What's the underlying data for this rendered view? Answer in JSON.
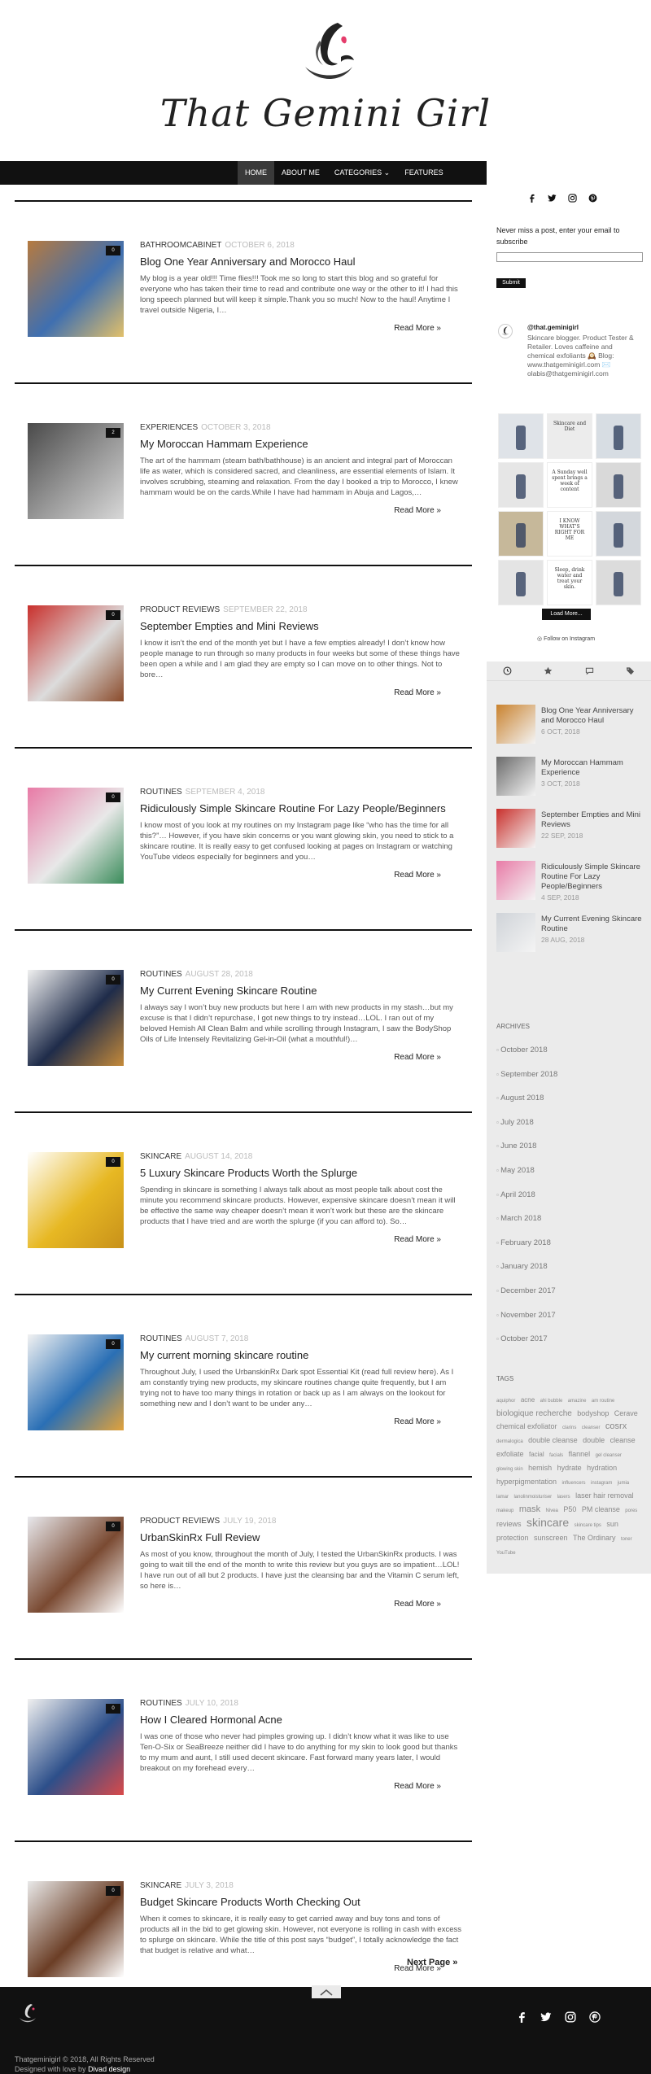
{
  "brand": {
    "title": "That Gemini Girl"
  },
  "nav": {
    "items": [
      "HOME",
      "ABOUT ME",
      "CATEGORIES ⌄",
      "FEATURES"
    ]
  },
  "posts": [
    {
      "category": "BATHROOMCABINET",
      "date": "OCTOBER 6, 2018",
      "title": "Blog One Year Anniversary and Morocco Haul",
      "excerpt": "My blog is a year old!!! Time flies!!! Took me so long to start this blog and so grateful for everyone who has taken their time to read and contribute one way or the other to it! I had this long speech planned but will keep it simple.Thank you so much! Now to the haul! Anytime I travel outside Nigeria, I…",
      "comments": "0",
      "more": "Read More »",
      "colors": [
        "#b67a3f",
        "#3f6fb0",
        "#e2c06a"
      ]
    },
    {
      "category": "EXPERIENCES",
      "date": "OCTOBER 3, 2018",
      "title": "My Moroccan Hammam Experience",
      "excerpt": "The art of the hammam (steam bath/bathhouse) is an ancient and integral part of Moroccan life as water, which is considered sacred, and cleanliness, are essential elements of Islam. It involves scrubbing, steaming and relaxation. From the day I booked a trip to Morocco, I knew hammam would be on the cards.While I have had hammam in Abuja and Lagos,…",
      "comments": "2",
      "more": "Read More »",
      "colors": [
        "#4a4a4a",
        "#9a9a9a",
        "#d8d8d8"
      ]
    },
    {
      "category": "PRODUCT REVIEWS",
      "date": "SEPTEMBER 22, 2018",
      "title": "September Empties and Mini Reviews",
      "excerpt": "I know it isn’t the end of the month yet but I have a few empties already! I don’t know how people manage to run through so many products in four weeks but some of these things have been open a while and I am glad they are empty so I can move on to other things. Not to bore…",
      "comments": "0",
      "more": "Read More »",
      "colors": [
        "#c9302c",
        "#dcdcdc",
        "#8a4a2a"
      ]
    },
    {
      "category": "ROUTINES",
      "date": "SEPTEMBER 4, 2018",
      "title": "Ridiculously Simple Skincare Routine For Lazy People/Beginners",
      "excerpt": "I know most of you look at my routines on my Instagram page like “who has the time for all this?”… However, if you have skin concerns or you want glowing skin, you need to stick to a skincare routine. It is really easy to get confused looking at pages on Instagram or watching YouTube videos especially for beginners and you…",
      "comments": "0",
      "more": "Read More »",
      "colors": [
        "#e87aa6",
        "#e8e8e8",
        "#3a8c5a"
      ]
    },
    {
      "category": "ROUTINES",
      "date": "AUGUST 28, 2018",
      "title": "My Current Evening Skincare Routine",
      "excerpt": "I always say I won’t buy new products but here I am with new products in my stash…but my excuse is that I didn’t repurchase, I got new things to try instead…LOL. I ran out of my beloved Hemish All Clean Balm and while scrolling through Instagram, I saw the BodyShop Oils of Life Intensely Revitalizing Gel-in-Oil (what a mouthful!)…",
      "comments": "0",
      "more": "Read More »",
      "colors": [
        "#f0f0f0",
        "#1f2c4a",
        "#c58a3a"
      ]
    },
    {
      "category": "SKINCARE",
      "date": "AUGUST 14, 2018",
      "title": "5 Luxury Skincare Products Worth the Splurge",
      "excerpt": "Spending in skincare is something I always talk about as most people talk about cost the minute you recommend skincare products. However, expensive skincare doesn’t mean it will be effective the same way cheaper doesn’t mean it won’t work but these are the skincare products that I have tried and are worth the splurge (if you can afford to). So…",
      "comments": "0",
      "more": "Read More »",
      "colors": [
        "#ffffff",
        "#e7b823",
        "#c8911a"
      ]
    },
    {
      "category": "ROUTINES",
      "date": "AUGUST 7, 2018",
      "title": "My current morning skincare routine",
      "excerpt": "Throughout July, I used the UrbanskinRx Dark spot Essential Kit (read full review here). As I am constantly trying new products, my skincare routines change quite frequently, but I am trying not to have too many things in rotation or back up as I am always on the lookout for something new and I don’t want to be under any…",
      "comments": "0",
      "more": "Read More »",
      "colors": [
        "#f2f2f2",
        "#2a6fb5",
        "#e2a23a"
      ]
    },
    {
      "category": "PRODUCT REVIEWS",
      "date": "JULY 19, 2018",
      "title": "UrbanSkinRx Full Review",
      "excerpt": "As most of you know, throughout the month of July, I tested the UrbanSkinRx products. I was going to wait till the end of the month to write this review but you guys are so impatient…LOL! I have run out of all but 2 products. I have just the cleansing bar and the Vitamin C serum left, so here is…",
      "comments": "0",
      "more": "Read More »",
      "colors": [
        "#e8e8ec",
        "#7a4a32",
        "#ffffff"
      ]
    },
    {
      "category": "ROUTINES",
      "date": "JULY 10, 2018",
      "title": "How I Cleared Hormonal Acne",
      "excerpt": "I was one of those who never had pimples growing up. I didn’t know what it was like to use Ten-O-Six or SeaBreeze neither did I have to do anything for my skin to look good but thanks to my mum and aunt, I still used decent skincare. Fast forward many years later, I would breakout on my forehead every…",
      "comments": "0",
      "more": "Read More »",
      "colors": [
        "#f0f0f0",
        "#2d4f8a",
        "#d94a4a"
      ]
    },
    {
      "category": "SKINCARE",
      "date": "JULY 3, 2018",
      "title": "Budget Skincare Products Worth Checking Out",
      "excerpt": "When it comes to skincare, it is really easy to get carried away and buy tons and tons of products all in the bid to get glowing skin. However, not everyone is rolling in cash with excess to splurge on skincare. While the title of this post says “budget”, I totally acknowledge the fact that budget is relative and what…",
      "comments": "0",
      "more": "Read More »",
      "colors": [
        "#e9e9e9",
        "#6b3e26",
        "#ffffff"
      ]
    }
  ],
  "pagination": {
    "next": "Next Page »"
  },
  "sidebar": {
    "subscribe_text": "Never miss a post, enter your email to subscribe",
    "subscribe_button": "Submit",
    "instagram": {
      "handle": "@that.geminigirl",
      "bio": "Skincare blogger. Product Tester & Retailer. Loves caffeine and chemical exfoliants 🕰️ Blog: www.thatgeminigirl.com ✉️ olabis@thatgeminigirl.com",
      "load_more": "Load More...",
      "follow": "Follow on Instagram",
      "tiles": [
        {
          "color": "#dfe3e8",
          "text": ""
        },
        {
          "color": "#ececec",
          "text": "Skincare and Diet"
        },
        {
          "color": "#d7dde3",
          "text": ""
        },
        {
          "color": "#e6e6e6",
          "text": ""
        },
        {
          "color": "#ffffff",
          "text": "A Sunday well spent brings a week of content"
        },
        {
          "color": "#d9d9d9",
          "text": ""
        },
        {
          "color": "#c6b89a",
          "text": ""
        },
        {
          "color": "#ffffff",
          "text": "I KNOW WHAT'S RIGHT FOR ME"
        },
        {
          "color": "#d3d7dc",
          "text": ""
        },
        {
          "color": "#e4e4e4",
          "text": ""
        },
        {
          "color": "#ffffff",
          "text": "Sleep, drink water and treat your skin."
        },
        {
          "color": "#dcdcdc",
          "text": ""
        }
      ]
    },
    "recent_posts": [
      {
        "title": "Blog One Year Anniversary and Morocco Haul",
        "date": "6 OCT, 2018",
        "color": "#c9822e"
      },
      {
        "title": "My Moroccan Hammam Experience",
        "date": "3 OCT, 2018",
        "color": "#6a6a6a"
      },
      {
        "title": "September Empties and Mini Reviews",
        "date": "22 SEP, 2018",
        "color": "#c9302c"
      },
      {
        "title": "Ridiculously Simple Skincare Routine For Lazy People/Beginners",
        "date": "4 SEP, 2018",
        "color": "#e87aa6"
      },
      {
        "title": "My Current Evening Skincare Routine",
        "date": "28 AUG, 2018",
        "color": "#cfd3d8"
      }
    ],
    "archives_heading": "ARCHIVES",
    "archives": [
      "October 2018",
      "September 2018",
      "August 2018",
      "July 2018",
      "June 2018",
      "May 2018",
      "April 2018",
      "March 2018",
      "February 2018",
      "January 2018",
      "December 2017",
      "November 2017",
      "October 2017"
    ],
    "tags_heading": "TAGS",
    "tags": [
      {
        "t": "aquiphor",
        "s": 6
      },
      {
        "t": "acne",
        "s": 8
      },
      {
        "t": "ahi bubble",
        "s": 6
      },
      {
        "t": "amazine",
        "s": 6
      },
      {
        "t": "am routine",
        "s": 6
      },
      {
        "t": "biologique recherche",
        "s": 10
      },
      {
        "t": "bodyshop",
        "s": 9
      },
      {
        "t": "Cerave",
        "s": 9
      },
      {
        "t": "chemical exfoliator",
        "s": 9
      },
      {
        "t": "clarins",
        "s": 6
      },
      {
        "t": "cleanser",
        "s": 6
      },
      {
        "t": "cosrx",
        "s": 11
      },
      {
        "t": "dermalogica",
        "s": 6
      },
      {
        "t": "double cleanse",
        "s": 9
      },
      {
        "t": "double",
        "s": 9
      },
      {
        "t": "cleanse",
        "s": 9
      },
      {
        "t": "exfoliate",
        "s": 9
      },
      {
        "t": "facial",
        "s": 8
      },
      {
        "t": "facials",
        "s": 6
      },
      {
        "t": "flannel",
        "s": 9
      },
      {
        "t": "gel cleanser",
        "s": 6
      },
      {
        "t": "glowing skin",
        "s": 6
      },
      {
        "t": "hemish",
        "s": 9
      },
      {
        "t": "hydrate",
        "s": 9
      },
      {
        "t": "hydration",
        "s": 9
      },
      {
        "t": "hyperpigmentation",
        "s": 9
      },
      {
        "t": "influencers",
        "s": 6
      },
      {
        "t": "instagram",
        "s": 6
      },
      {
        "t": "jumia",
        "s": 6
      },
      {
        "t": "lamar",
        "s": 6
      },
      {
        "t": "lanolinmoisturiser",
        "s": 6
      },
      {
        "t": "lasers",
        "s": 6
      },
      {
        "t": "laser hair removal",
        "s": 9
      },
      {
        "t": "makeup",
        "s": 6
      },
      {
        "t": "mask",
        "s": 11
      },
      {
        "t": "Nivea",
        "s": 6
      },
      {
        "t": "P50",
        "s": 9
      },
      {
        "t": "PM cleanse",
        "s": 9
      },
      {
        "t": "pores",
        "s": 6
      },
      {
        "t": "reviews",
        "s": 9
      },
      {
        "t": "skincare",
        "s": 14
      },
      {
        "t": "skincare tips",
        "s": 6
      },
      {
        "t": "sun",
        "s": 9
      },
      {
        "t": "protection",
        "s": 9
      },
      {
        "t": "sunscreen",
        "s": 9
      },
      {
        "t": "The Ordinary",
        "s": 9
      },
      {
        "t": "toner",
        "s": 6
      },
      {
        "t": "YouTube",
        "s": 6
      }
    ]
  },
  "footer": {
    "copyright": "Thatgeminigirl © 2018, All Rights Reserved",
    "credit_prefix": "Designed with love by ",
    "credit_name": "Divad design"
  },
  "colors": {
    "nav_bg": "#111111",
    "accent": "#e53c6b",
    "footer_bg": "#111111"
  }
}
